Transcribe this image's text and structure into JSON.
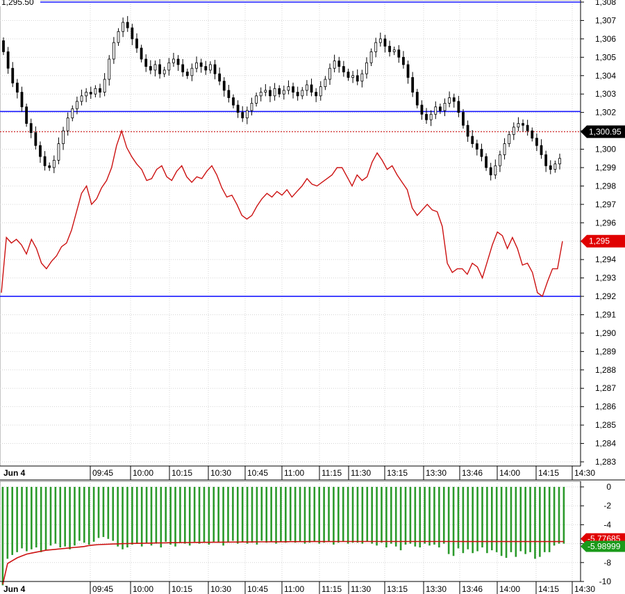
{
  "chart_data": [
    {
      "type": "candlestick",
      "title": "",
      "corner_label": "1,295.50",
      "date_label": "Jun 4",
      "x_tick_labels": [
        "09:45",
        "10:00",
        "10:15",
        "10:30",
        "10:45",
        "11:00",
        "11:15",
        "11:30",
        "13:15",
        "13:30",
        "13:46",
        "14:00",
        "14:15",
        "14:30"
      ],
      "ylim": [
        1282.6,
        1308
      ],
      "y_ticks": [
        1308,
        1307,
        1306,
        1305,
        1304,
        1303,
        1302,
        1301,
        1300,
        1299,
        1298,
        1297,
        1296,
        1295,
        1294,
        1293,
        1292,
        1291,
        1290,
        1289,
        1288,
        1287,
        1286,
        1285,
        1284,
        1283
      ],
      "y_tick_labels": [
        "1,308",
        "1,307",
        "1,306",
        "1,305",
        "1,304",
        "1,303",
        "1,302",
        "",
        "1,300",
        "1,299",
        "1,298",
        "1,297",
        "1,296",
        "",
        "1,294",
        "1,293",
        "1,292",
        "1,291",
        "1,290",
        "1,289",
        "1,288",
        "1,287",
        "1,286",
        "1,285",
        "1,284",
        "1,283"
      ],
      "horizontal_lines": [
        {
          "y": 1308,
          "color": "#1a1aff",
          "style": "solid"
        },
        {
          "y": 1302.05,
          "color": "#1a1aff",
          "style": "solid"
        },
        {
          "y": 1292,
          "color": "#1a1aff",
          "style": "solid"
        },
        {
          "y": 1300.95,
          "color": "#cc0000",
          "style": "dotted"
        }
      ],
      "last_price_tags": [
        {
          "y": 1300.95,
          "text": "1,300.95",
          "color": "#000000"
        },
        {
          "y": 1295.0,
          "text": "1,295",
          "color": "#e00000"
        }
      ],
      "grid": true,
      "series": [
        {
          "kind": "candles",
          "up_color": "#ffffff",
          "down_color": "#000000",
          "close_path": [
            1305.3,
            1304.4,
            1303.6,
            1303.1,
            1302.3,
            1301.4,
            1300.9,
            1300.2,
            1299.6,
            1299.1,
            1299.0,
            1299.4,
            1300.3,
            1301.0,
            1301.7,
            1302.2,
            1302.6,
            1302.9,
            1303.1,
            1303.0,
            1303.3,
            1303.1,
            1303.8,
            1304.9,
            1305.8,
            1306.4,
            1306.9,
            1306.6,
            1306.0,
            1305.5,
            1304.9,
            1304.5,
            1304.3,
            1304.6,
            1304.1,
            1304.3,
            1304.7,
            1304.9,
            1304.6,
            1304.2,
            1304.0,
            1304.4,
            1304.7,
            1304.5,
            1304.3,
            1304.6,
            1304.1,
            1303.7,
            1303.2,
            1302.8,
            1302.4,
            1302.0,
            1301.7,
            1302.1,
            1302.5,
            1302.9,
            1303.1,
            1303.2,
            1302.9,
            1303.3,
            1303.0,
            1303.2,
            1303.4,
            1303.1,
            1302.9,
            1303.2,
            1303.5,
            1303.1,
            1302.9,
            1303.4,
            1303.8,
            1304.4,
            1304.8,
            1304.5,
            1304.2,
            1303.9,
            1304.0,
            1303.7,
            1304.1,
            1304.7,
            1305.3,
            1305.8,
            1306.0,
            1305.6,
            1305.3,
            1305.4,
            1305.0,
            1304.6,
            1303.9,
            1303.1,
            1302.4,
            1301.9,
            1301.6,
            1301.9,
            1302.3,
            1302.1,
            1302.5,
            1302.8,
            1302.6,
            1302.0,
            1301.3,
            1300.7,
            1300.3,
            1300.0,
            1299.6,
            1299.0,
            1298.6,
            1299.1,
            1299.7,
            1300.3,
            1300.8,
            1301.2,
            1301.4,
            1301.3,
            1301.0,
            1300.6,
            1300.2,
            1299.7,
            1299.1,
            1298.9,
            1299.2,
            1299.5
          ]
        },
        {
          "kind": "line",
          "color": "#cc1111",
          "values": [
            1292.2,
            1295.2,
            1294.9,
            1295.1,
            1294.8,
            1294.3,
            1295.1,
            1294.6,
            1293.8,
            1293.5,
            1293.9,
            1294.2,
            1294.7,
            1294.9,
            1295.6,
            1296.6,
            1297.6,
            1298.0,
            1297.0,
            1297.3,
            1297.9,
            1298.3,
            1299.0,
            1300.2,
            1301.0,
            1300.1,
            1299.6,
            1299.2,
            1298.9,
            1298.3,
            1298.4,
            1298.9,
            1299.1,
            1298.5,
            1298.3,
            1298.8,
            1299.1,
            1298.5,
            1298.2,
            1298.5,
            1298.4,
            1298.8,
            1299.1,
            1298.6,
            1297.9,
            1297.4,
            1297.5,
            1297.0,
            1296.4,
            1296.2,
            1296.4,
            1296.9,
            1297.3,
            1297.6,
            1297.4,
            1297.7,
            1297.5,
            1297.8,
            1297.4,
            1297.7,
            1298.0,
            1298.4,
            1298.1,
            1298.0,
            1298.2,
            1298.4,
            1298.6,
            1299.0,
            1299.0,
            1298.5,
            1298.0,
            1298.6,
            1298.3,
            1298.5,
            1299.3,
            1299.8,
            1299.4,
            1298.9,
            1299.1,
            1298.6,
            1298.2,
            1297.8,
            1296.8,
            1296.4,
            1296.7,
            1297.0,
            1296.7,
            1296.6,
            1295.8,
            1293.8,
            1293.3,
            1293.5,
            1293.5,
            1293.2,
            1293.8,
            1293.6,
            1293.0,
            1293.9,
            1294.8,
            1295.5,
            1295.3,
            1294.6,
            1295.2,
            1294.6,
            1293.7,
            1293.8,
            1293.3,
            1292.2,
            1292.0,
            1292.8,
            1293.5,
            1293.5,
            1295.0
          ]
        }
      ]
    },
    {
      "type": "bar",
      "title": "",
      "date_label": "Jun 4",
      "x_tick_labels": [
        "09:45",
        "10:00",
        "10:15",
        "10:30",
        "10:45",
        "11:00",
        "11:15",
        "11:30",
        "13:15",
        "13:30",
        "13:46",
        "14:00",
        "14:15",
        "14:30"
      ],
      "ylim": [
        -10.6,
        0.6
      ],
      "y_ticks": [
        0,
        -2,
        -4,
        -6,
        -8,
        -10
      ],
      "y_tick_labels": [
        "0",
        "-2",
        "-4",
        "-6",
        "-8",
        "-10"
      ],
      "last_value_tags": [
        {
          "y": -5.77685,
          "text": "-5.77685",
          "color": "#e00000"
        },
        {
          "y": -5.98999,
          "text": "-5.98999",
          "color": "#1a9a1a"
        }
      ],
      "series": [
        {
          "kind": "bars",
          "color": "#2b9a2b",
          "values": [
            -10.4,
            -7.6,
            -7.2,
            -6.9,
            -6.5,
            -6.8,
            -6.6,
            -6.4,
            -6.9,
            -6.7,
            -6.2,
            -6.0,
            -6.4,
            -6.3,
            -6.6,
            -6.2,
            -5.7,
            -5.9,
            -6.1,
            -5.8,
            -5.4,
            -5.3,
            -5.5,
            -5.7,
            -6.3,
            -6.6,
            -6.4,
            -6.1,
            -6.0,
            -6.3,
            -5.9,
            -6.2,
            -6.0,
            -6.4,
            -5.8,
            -6.1,
            -6.3,
            -5.9,
            -6.0,
            -6.2,
            -5.8,
            -6.0,
            -5.9,
            -6.1,
            -5.8,
            -5.9,
            -6.2,
            -5.8,
            -5.7,
            -6.0,
            -5.8,
            -6.0,
            -5.9,
            -6.1,
            -5.7,
            -5.9,
            -5.8,
            -6.0,
            -5.8,
            -5.9,
            -5.7,
            -5.9,
            -5.8,
            -6.0,
            -5.9,
            -5.8,
            -6.0,
            -5.9,
            -5.8,
            -6.1,
            -5.9,
            -5.8,
            -6.0,
            -5.9,
            -5.9,
            -6.0,
            -5.8,
            -6.0,
            -6.2,
            -5.9,
            -6.4,
            -6.0,
            -6.3,
            -6.7,
            -6.1,
            -6.0,
            -6.3,
            -6.4,
            -6.0,
            -6.2,
            -6.1,
            -6.4,
            -6.0,
            -7.1,
            -7.3,
            -6.5,
            -7.0,
            -6.6,
            -7.0,
            -6.8,
            -6.4,
            -7.0,
            -6.7,
            -6.9,
            -7.3,
            -7.5,
            -6.9,
            -7.4,
            -6.8,
            -7.1,
            -6.9,
            -7.6,
            -7.4,
            -6.9,
            -6.9,
            -6.2,
            -6.0,
            -6.0
          ]
        },
        {
          "kind": "line",
          "color": "#cc1111",
          "values": [
            -10.3,
            -8.1,
            -7.8,
            -7.5,
            -7.3,
            -7.1,
            -7.0,
            -6.9,
            -6.8,
            -6.7,
            -6.65,
            -6.6,
            -6.55,
            -6.5,
            -6.45,
            -6.4,
            -6.35,
            -6.3,
            -6.2,
            -6.15,
            -6.1,
            -6.08,
            -6.06,
            -6.04,
            -6.02,
            -6.0,
            -5.99,
            -5.98,
            -5.97,
            -5.96,
            -5.95,
            -5.94,
            -5.93,
            -5.92,
            -5.91,
            -5.9,
            -5.9,
            -5.89,
            -5.88,
            -5.88,
            -5.87,
            -5.87,
            -5.86,
            -5.86,
            -5.85,
            -5.85,
            -5.84,
            -5.84,
            -5.83,
            -5.83,
            -5.82,
            -5.82,
            -5.82,
            -5.81,
            -5.81,
            -5.81,
            -5.8,
            -5.8,
            -5.8,
            -5.8,
            -5.79,
            -5.79,
            -5.79,
            -5.79,
            -5.78,
            -5.78,
            -5.78,
            -5.78,
            -5.78,
            -5.78,
            -5.77,
            -5.77,
            -5.77,
            -5.77,
            -5.77,
            -5.77,
            -5.77,
            -5.77,
            -5.77,
            -5.77,
            -5.77,
            -5.77,
            -5.77,
            -5.77,
            -5.77,
            -5.77,
            -5.77,
            -5.77,
            -5.77,
            -5.77,
            -5.77,
            -5.77,
            -5.77,
            -5.77,
            -5.77,
            -5.77,
            -5.78,
            -5.78,
            -5.78,
            -5.78,
            -5.78,
            -5.78,
            -5.78,
            -5.78,
            -5.78,
            -5.78,
            -5.78,
            -5.78,
            -5.78,
            -5.78,
            -5.78,
            -5.78,
            -5.78,
            -5.78,
            -5.78,
            -5.78,
            -5.78,
            -5.77685
          ]
        }
      ]
    }
  ]
}
